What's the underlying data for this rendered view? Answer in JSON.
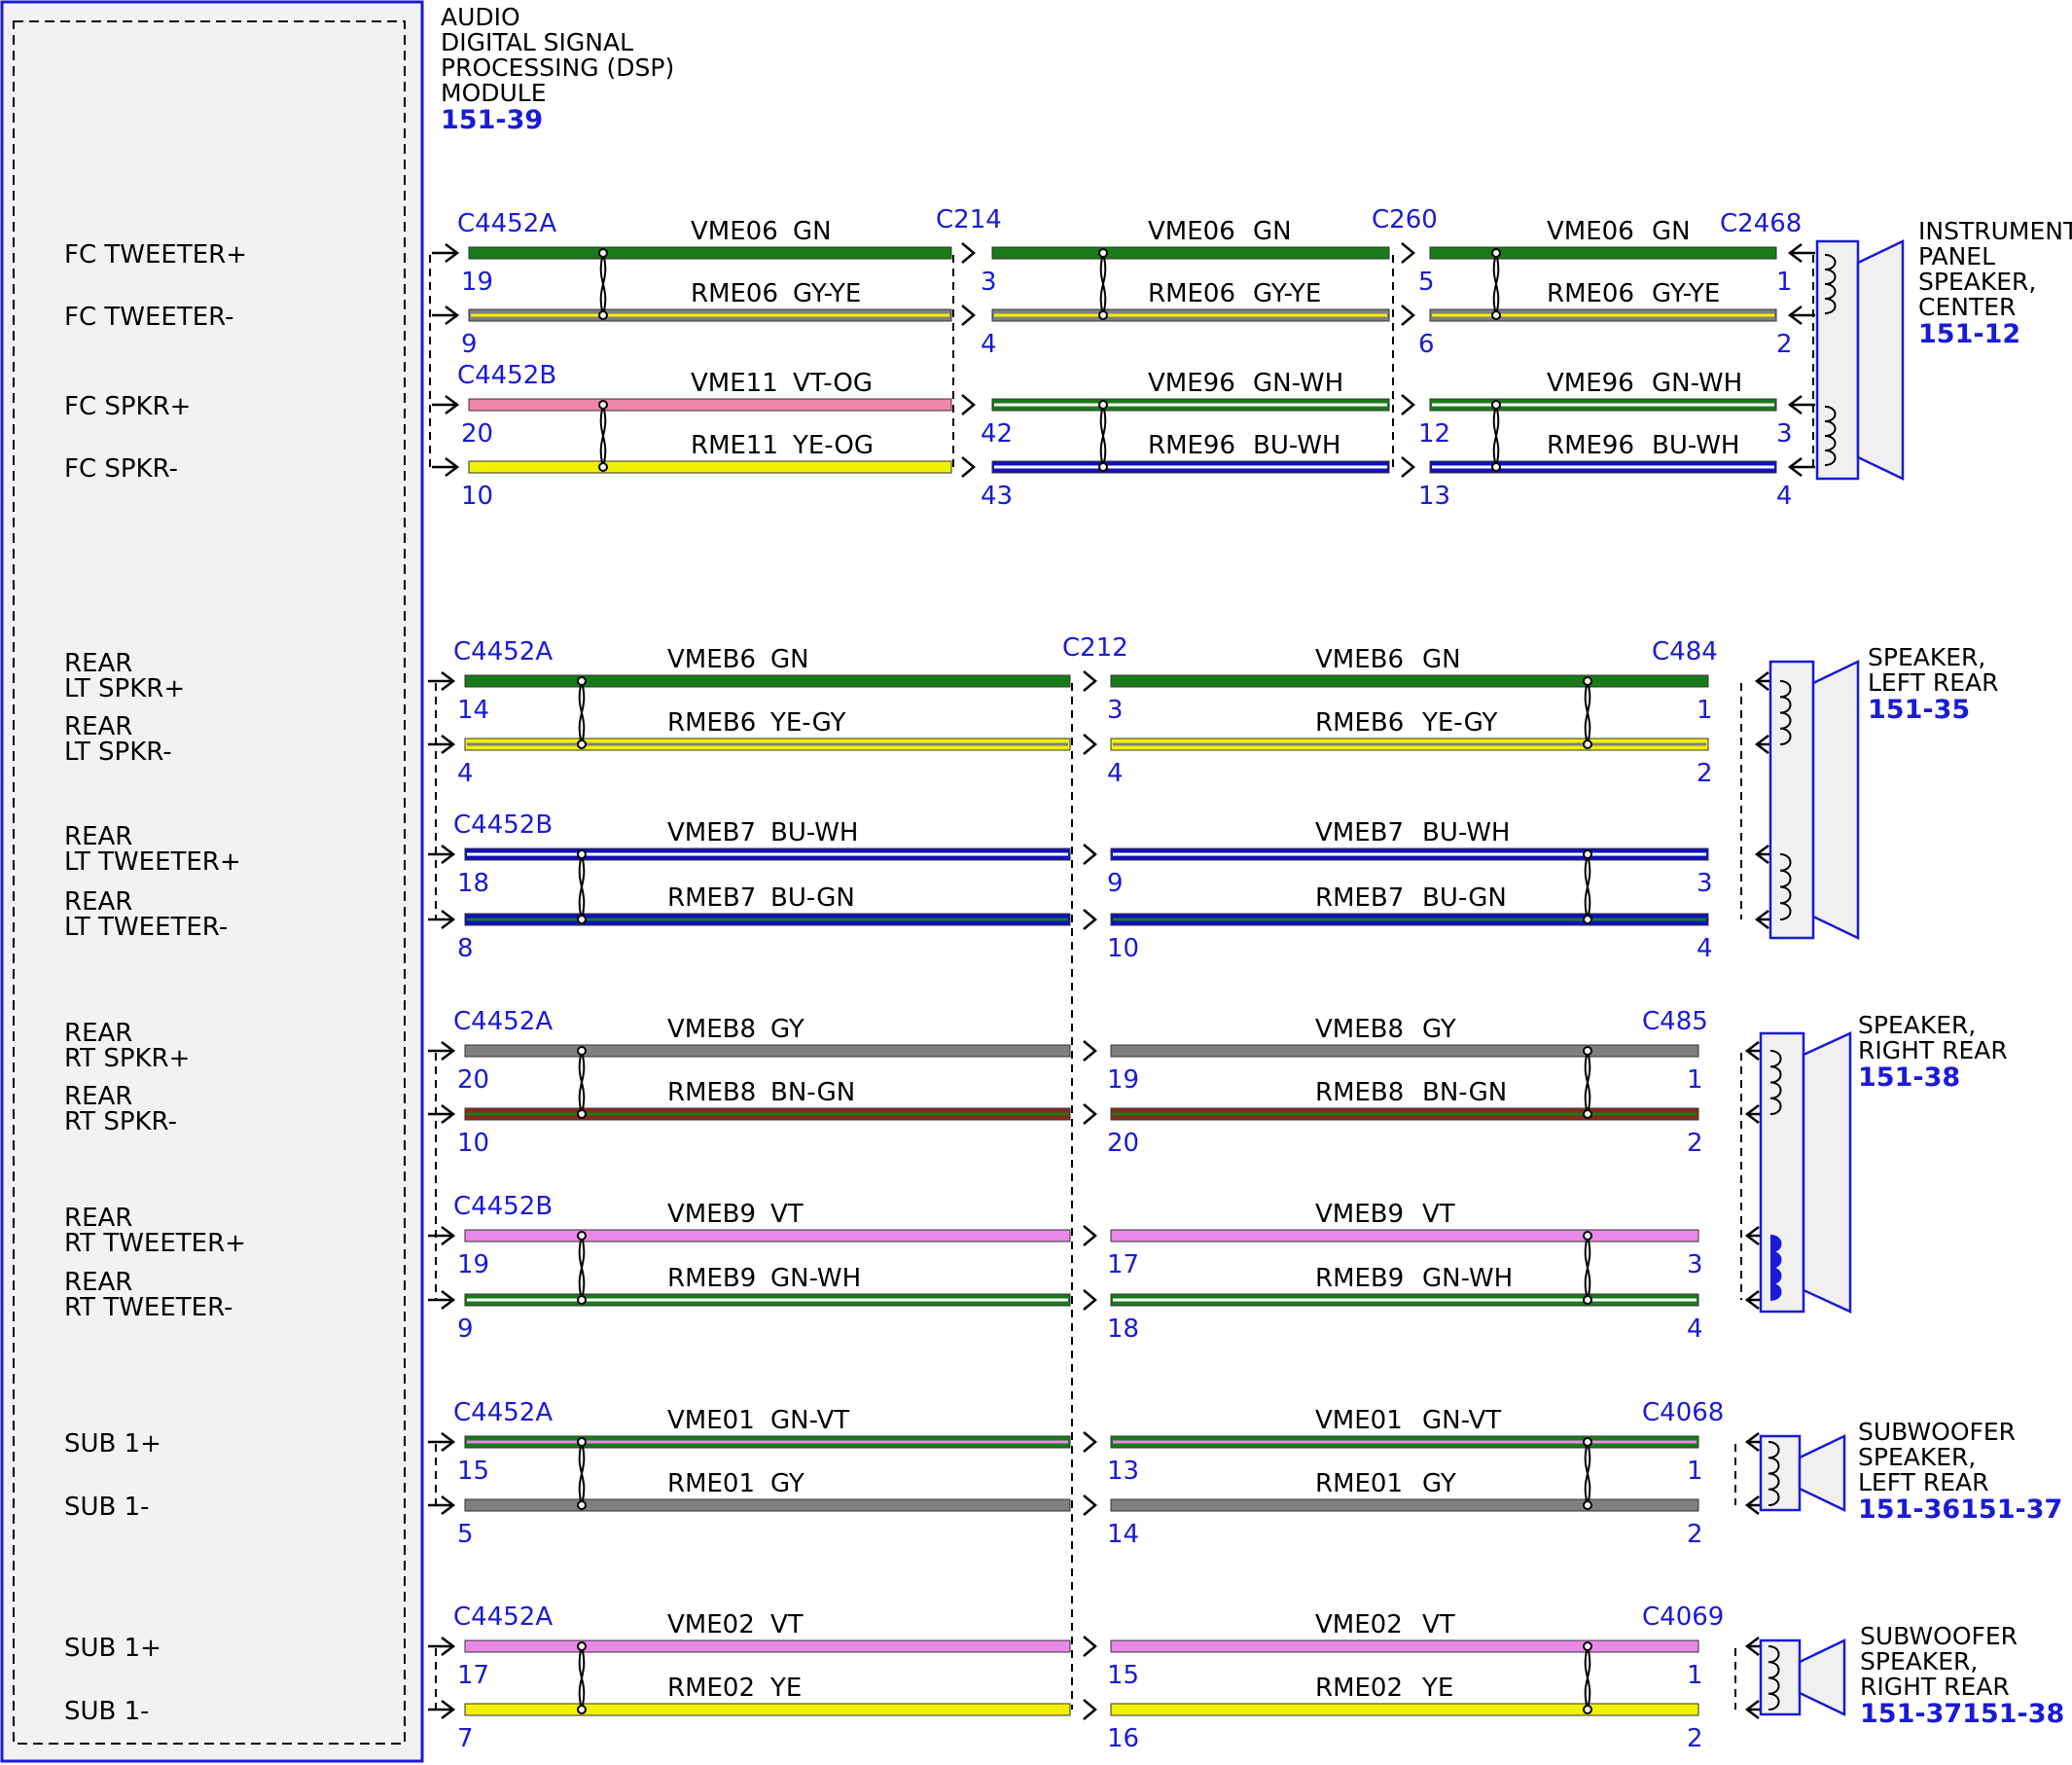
{
  "module": {
    "title_lines": [
      "AUDIO",
      "DIGITAL SIGNAL",
      "PROCESSING (DSP)",
      "MODULE"
    ],
    "ref": "151-39"
  },
  "colors": {
    "GN": "#1a7a1a",
    "GY": "#808080",
    "YE": "#f2f200",
    "VT": "#e888e8",
    "BU": "#1010c0",
    "WH": "#ffffff",
    "OG": "#ff8a2a",
    "BN": "#8b2a1a",
    "PK": "#ee88aa",
    "blue_text": "#1a1ad6"
  },
  "devices": [
    {
      "id": "ip",
      "lines": [
        "INSTRUMENT",
        "PANEL",
        "SPEAKER,",
        "CENTER"
      ],
      "ref": "151-12"
    },
    {
      "id": "lr",
      "lines": [
        "SPEAKER,",
        "LEFT REAR"
      ],
      "ref": "151-35"
    },
    {
      "id": "rr",
      "lines": [
        "SPEAKER,",
        "RIGHT REAR"
      ],
      "ref": "151-38"
    },
    {
      "id": "subl",
      "lines": [
        "SUBWOOFER",
        "SPEAKER,",
        "LEFT REAR"
      ],
      "ref": "151-36151-37"
    },
    {
      "id": "subr",
      "lines": [
        "SUBWOOFER",
        "SPEAKER,",
        "RIGHT REAR"
      ],
      "ref": "151-37151-38"
    }
  ],
  "circuits": [
    {
      "signal": [
        "FC TWEETER+"
      ],
      "seg1": {
        "circuit": "VME06",
        "color": "GN",
        "stripe": ""
      },
      "seg2": {
        "circuit": "VME06",
        "color": "GN",
        "stripe": ""
      },
      "seg3": {
        "circuit": "VME06",
        "color": "GN",
        "stripe": ""
      },
      "c1": "C4452A",
      "c2": "C214",
      "c3": "C260",
      "c4": "C2468",
      "p1": "19",
      "p2": "3",
      "p3": "5",
      "p4": "1"
    },
    {
      "signal": [
        "FC TWEETER-"
      ],
      "seg1": {
        "circuit": "RME06",
        "color": "GY-YE",
        "stripe": "YE"
      },
      "seg2": {
        "circuit": "RME06",
        "color": "GY-YE",
        "stripe": "YE"
      },
      "seg3": {
        "circuit": "RME06",
        "color": "GY-YE",
        "stripe": "YE"
      },
      "c1": "",
      "c2": "",
      "c3": "",
      "c4": "",
      "p1": "9",
      "p2": "4",
      "p3": "6",
      "p4": "2"
    },
    {
      "signal": [
        "FC SPKR+"
      ],
      "seg1": {
        "circuit": "VME11",
        "color": "VT-OG",
        "stripe": ""
      },
      "seg2": {
        "circuit": "VME96",
        "color": "GN-WH",
        "stripe": "WH"
      },
      "seg3": {
        "circuit": "VME96",
        "color": "GN-WH",
        "stripe": "WH"
      },
      "c1": "C4452B",
      "c2": "",
      "c3": "",
      "c4": "",
      "p1": "20",
      "p2": "42",
      "p3": "12",
      "p4": "3"
    },
    {
      "signal": [
        "FC SPKR-"
      ],
      "seg1": {
        "circuit": "RME11",
        "color": "YE-OG",
        "stripe": ""
      },
      "seg2": {
        "circuit": "RME96",
        "color": "BU-WH",
        "stripe": "WH"
      },
      "seg3": {
        "circuit": "RME96",
        "color": "BU-WH",
        "stripe": "WH"
      },
      "c1": "",
      "c2": "",
      "c3": "",
      "c4": "",
      "p1": "10",
      "p2": "43",
      "p3": "13",
      "p4": "4"
    },
    {
      "signal": [
        "REAR",
        "LT SPKR+"
      ],
      "seg1": {
        "circuit": "VMEB6",
        "color": "GN",
        "stripe": ""
      },
      "seg2": {
        "circuit": "VMEB6",
        "color": "GN",
        "stripe": ""
      },
      "c1": "C4452A",
      "c2": "C212",
      "c4": "C484",
      "p1": "14",
      "p2": "3",
      "p4": "1"
    },
    {
      "signal": [
        "REAR",
        "LT SPKR-"
      ],
      "seg1": {
        "circuit": "RMEB6",
        "color": "YE-GY",
        "stripe": "GY"
      },
      "seg2": {
        "circuit": "RMEB6",
        "color": "YE-GY",
        "stripe": "GY"
      },
      "c1": "",
      "c2": "",
      "c4": "",
      "p1": "4",
      "p2": "4",
      "p4": "2"
    },
    {
      "signal": [
        "REAR",
        "LT TWEETER+"
      ],
      "seg1": {
        "circuit": "VMEB7",
        "color": "BU-WH",
        "stripe": "WH"
      },
      "seg2": {
        "circuit": "VMEB7",
        "color": "BU-WH",
        "stripe": "WH"
      },
      "c1": "C4452B",
      "c2": "",
      "c4": "",
      "p1": "18",
      "p2": "9",
      "p4": "3"
    },
    {
      "signal": [
        "REAR",
        "LT TWEETER-"
      ],
      "seg1": {
        "circuit": "RMEB7",
        "color": "BU-GN",
        "stripe": "GN"
      },
      "seg2": {
        "circuit": "RMEB7",
        "color": "BU-GN",
        "stripe": "GN"
      },
      "c1": "",
      "c2": "",
      "c4": "",
      "p1": "8",
      "p2": "10",
      "p4": "4"
    },
    {
      "signal": [
        "REAR",
        "RT SPKR+"
      ],
      "seg1": {
        "circuit": "VMEB8",
        "color": "GY",
        "stripe": ""
      },
      "seg2": {
        "circuit": "VMEB8",
        "color": "GY",
        "stripe": ""
      },
      "c1": "C4452A",
      "c2": "",
      "c4": "C485",
      "p1": "20",
      "p2": "19",
      "p4": "1"
    },
    {
      "signal": [
        "REAR",
        "RT SPKR-"
      ],
      "seg1": {
        "circuit": "RMEB8",
        "color": "BN-GN",
        "stripe": "GN"
      },
      "seg2": {
        "circuit": "RMEB8",
        "color": "BN-GN",
        "stripe": "GN"
      },
      "c1": "",
      "c2": "",
      "c4": "",
      "p1": "10",
      "p2": "20",
      "p4": "2"
    },
    {
      "signal": [
        "REAR",
        "RT TWEETER+"
      ],
      "seg1": {
        "circuit": "VMEB9",
        "color": "VT",
        "stripe": ""
      },
      "seg2": {
        "circuit": "VMEB9",
        "color": "VT",
        "stripe": ""
      },
      "c1": "C4452B",
      "c2": "",
      "c4": "",
      "p1": "19",
      "p2": "17",
      "p4": "3"
    },
    {
      "signal": [
        "REAR",
        "RT TWEETER-"
      ],
      "seg1": {
        "circuit": "RMEB9",
        "color": "GN-WH",
        "stripe": "WH"
      },
      "seg2": {
        "circuit": "RMEB9",
        "color": "GN-WH",
        "stripe": "WH"
      },
      "c1": "",
      "c2": "",
      "c4": "",
      "p1": "9",
      "p2": "18",
      "p4": "4"
    },
    {
      "signal": [
        "SUB 1+"
      ],
      "seg1": {
        "circuit": "VME01",
        "color": "GN-VT",
        "stripe": "VT"
      },
      "seg2": {
        "circuit": "VME01",
        "color": "GN-VT",
        "stripe": "VT"
      },
      "c1": "C4452A",
      "c2": "",
      "c4": "C4068",
      "p1": "15",
      "p2": "13",
      "p4": "1"
    },
    {
      "signal": [
        "SUB 1-"
      ],
      "seg1": {
        "circuit": "RME01",
        "color": "GY",
        "stripe": ""
      },
      "seg2": {
        "circuit": "RME01",
        "color": "GY",
        "stripe": ""
      },
      "c1": "",
      "c2": "",
      "c4": "",
      "p1": "5",
      "p2": "14",
      "p4": "2"
    },
    {
      "signal": [
        "SUB 1+"
      ],
      "seg1": {
        "circuit": "VME02",
        "color": "VT",
        "stripe": ""
      },
      "seg2": {
        "circuit": "VME02",
        "color": "VT",
        "stripe": ""
      },
      "c1": "C4452A",
      "c2": "",
      "c4": "C4069",
      "p1": "17",
      "p2": "15",
      "p4": "1"
    },
    {
      "signal": [
        "SUB 1-"
      ],
      "seg1": {
        "circuit": "RME02",
        "color": "YE",
        "stripe": ""
      },
      "seg2": {
        "circuit": "RME02",
        "color": "YE",
        "stripe": ""
      },
      "c1": "",
      "c2": "",
      "c4": "",
      "p1": "7",
      "p2": "16",
      "p4": "2"
    }
  ]
}
